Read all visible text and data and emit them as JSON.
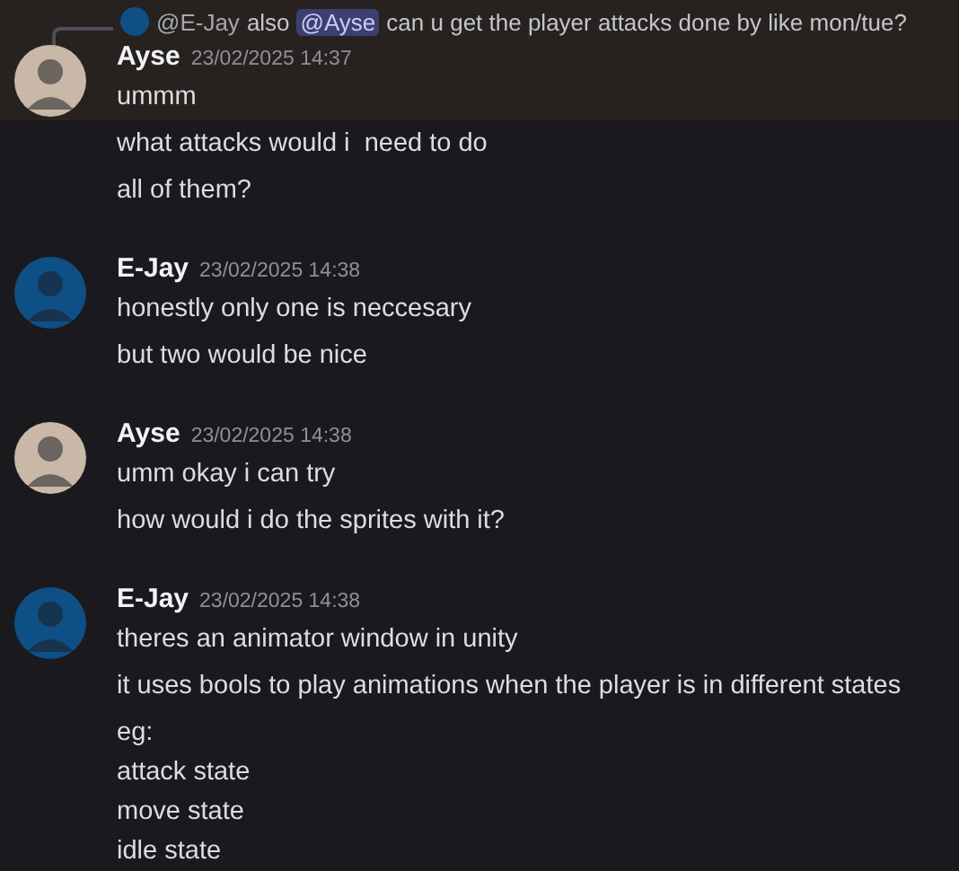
{
  "groups": [
    {
      "author": "Ayse",
      "timestamp": "23/02/2025 14:37",
      "color": "#c9b8a8",
      "reply": {
        "author": "@E-Jay",
        "color": "#0e4f86",
        "parts": [
          {
            "kind": "text",
            "text": "also"
          },
          {
            "kind": "mention",
            "text": "@Ayse"
          },
          {
            "kind": "text",
            "text": "can u get the player attacks done by like mon/tue?"
          }
        ]
      },
      "messages": [
        {
          "lines": [
            "ummm"
          ],
          "highlighted": true
        },
        {
          "lines": [
            "what attacks would i  need to do"
          ],
          "highlighted": false
        },
        {
          "lines": [
            "all of them?"
          ],
          "highlighted": false
        }
      ]
    },
    {
      "author": "E-Jay",
      "timestamp": "23/02/2025 14:38",
      "color": "#0e4f86",
      "messages": [
        {
          "lines": [
            "honestly only one is neccesary"
          ],
          "highlighted": false
        },
        {
          "lines": [
            "but two would be nice"
          ],
          "highlighted": false
        }
      ]
    },
    {
      "author": "Ayse",
      "timestamp": "23/02/2025 14:38",
      "color": "#c9b8a8",
      "messages": [
        {
          "lines": [
            "umm okay i can try"
          ],
          "highlighted": false
        },
        {
          "lines": [
            "how would i do the sprites with it?"
          ],
          "highlighted": false
        }
      ]
    },
    {
      "author": "E-Jay",
      "timestamp": "23/02/2025 14:38",
      "color": "#0e4f86",
      "messages": [
        {
          "lines": [
            "theres an animator window in unity"
          ],
          "highlighted": false
        },
        {
          "lines": [
            "it uses bools to play animations when the player is in different states"
          ],
          "highlighted": false
        },
        {
          "lines": [
            "eg:",
            "attack state",
            "move state",
            "idle state"
          ],
          "highlighted": false
        }
      ]
    }
  ]
}
